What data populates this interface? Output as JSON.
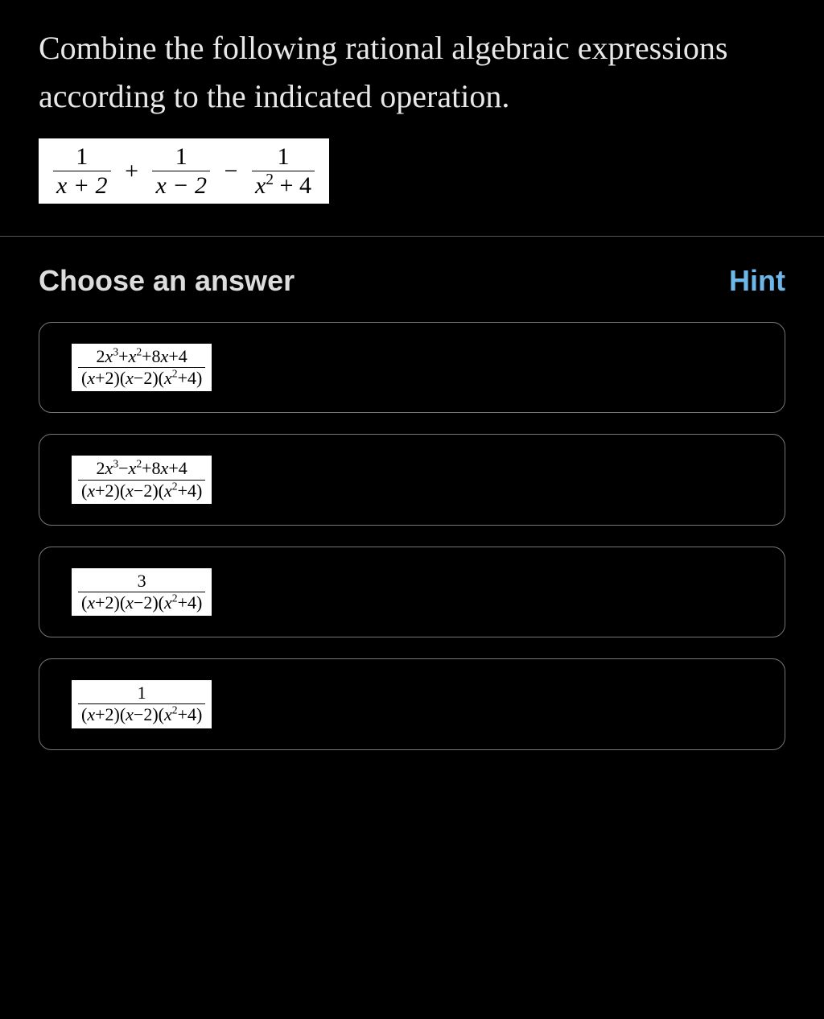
{
  "question": {
    "prompt": "Combine the following rational algebraic expressions according to the indicated operation.",
    "expression": {
      "term1": {
        "num": "1",
        "den": "x + 2"
      },
      "op1": "+",
      "term2": {
        "num": "1",
        "den": "x − 2"
      },
      "op2": "−",
      "term3": {
        "num": "1",
        "den_base": "x",
        "den_exp": "2",
        "den_tail": " + 4"
      }
    }
  },
  "answer": {
    "choose_label": "Choose an answer",
    "hint_label": "Hint",
    "options": [
      {
        "num_pre": "2",
        "num_t1b": "x",
        "num_t1e": "3",
        "num_s1": "+",
        "num_t2b": "x",
        "num_t2e": "2",
        "num_s2": "+8",
        "num_t3b": "x",
        "num_tail": "+4",
        "den_pre": "(",
        "den_a": "x",
        "den_a2": "+2)(",
        "den_b": "x",
        "den_b2": "−2)(",
        "den_c": "x",
        "den_ce": "2",
        "den_tail": "+4)"
      },
      {
        "num_pre": "2",
        "num_t1b": "x",
        "num_t1e": "3",
        "num_s1": "−",
        "num_t2b": "x",
        "num_t2e": "2",
        "num_s2": "+8",
        "num_t3b": "x",
        "num_tail": "+4",
        "den_pre": "(",
        "den_a": "x",
        "den_a2": "+2)(",
        "den_b": "x",
        "den_b2": "−2)(",
        "den_c": "x",
        "den_ce": "2",
        "den_tail": "+4)"
      },
      {
        "num_simple": "3",
        "den_pre": "(",
        "den_a": "x",
        "den_a2": "+2)(",
        "den_b": "x",
        "den_b2": "−2)(",
        "den_c": "x",
        "den_ce": "2",
        "den_tail": "+4)"
      },
      {
        "num_simple": "1",
        "den_pre": "(",
        "den_a": "x",
        "den_a2": "+2)(",
        "den_b": "x",
        "den_b2": "−2)(",
        "den_c": "x",
        "den_ce": "2",
        "den_tail": "+4)"
      }
    ]
  }
}
